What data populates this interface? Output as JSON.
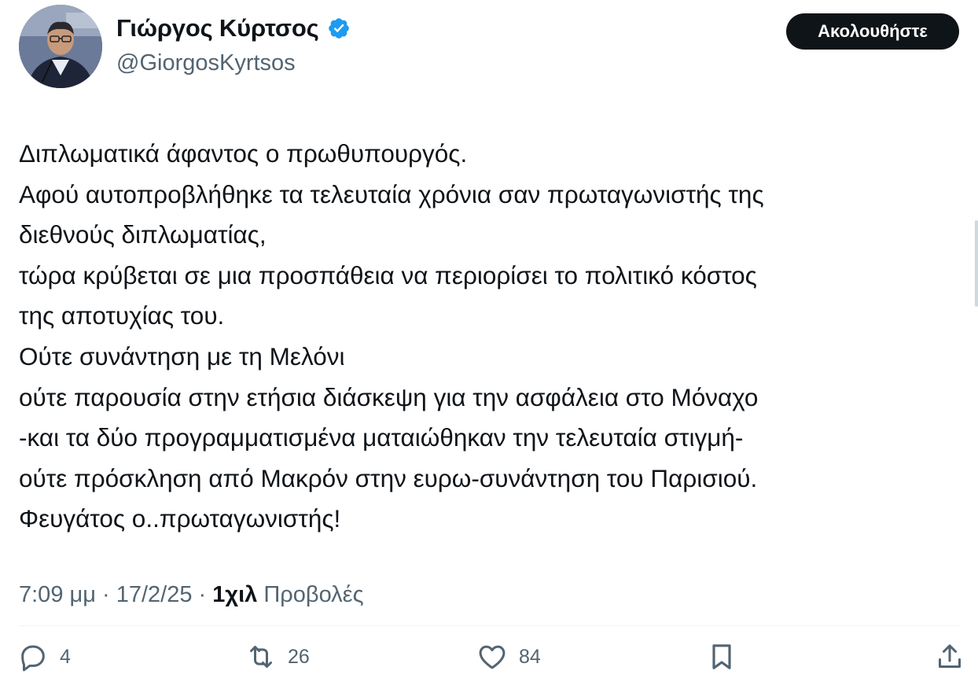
{
  "author": {
    "display_name": "Γιώργος Κύρτσος",
    "handle": "@GiorgosKyrtsos",
    "verified": true,
    "avatar_icon": "profile-photo"
  },
  "follow_button": {
    "label": "Ακολουθήστε"
  },
  "tweet": {
    "lines": [
      "Διπλωματικά άφαντος ο πρωθυπουργός.",
      "Αφού αυτοπροβλήθηκε τα τελευταία χρόνια σαν πρωταγωνιστής της",
      "διεθνούς διπλωματίας,",
      "τώρα κρύβεται σε μια προσπάθεια να περιορίσει το πολιτικό κόστος",
      "της αποτυχίας του.",
      "Ούτε συνάντηση με τη Μελόνι",
      "ούτε παρουσία στην ετήσια διάσκεψη για την ασφάλεια στο Μόναχο",
      "-και τα δύο προγραμματισμένα ματαιώθηκαν την τελευταία στιγμή-",
      "ούτε πρόσκληση από Μακρόν στην ευρω-συνάντηση του Παρισιού.",
      "Φευγάτος ο..πρωταγωνιστής!"
    ]
  },
  "meta": {
    "time": "7:09 μμ",
    "separator": " · ",
    "date": "17/2/25",
    "views_count": "1χιλ",
    "views_label": " Προβολές"
  },
  "actions": {
    "reply": {
      "icon": "reply-icon",
      "count": "4"
    },
    "repost": {
      "icon": "repost-icon",
      "count": "26"
    },
    "like": {
      "icon": "heart-icon",
      "count": "84"
    },
    "bookmark": {
      "icon": "bookmark-icon"
    },
    "share": {
      "icon": "share-icon"
    }
  },
  "colors": {
    "text": "#0f1419",
    "secondary": "#536471",
    "verified": "#1d9bf0",
    "button_bg": "#0f1419"
  }
}
